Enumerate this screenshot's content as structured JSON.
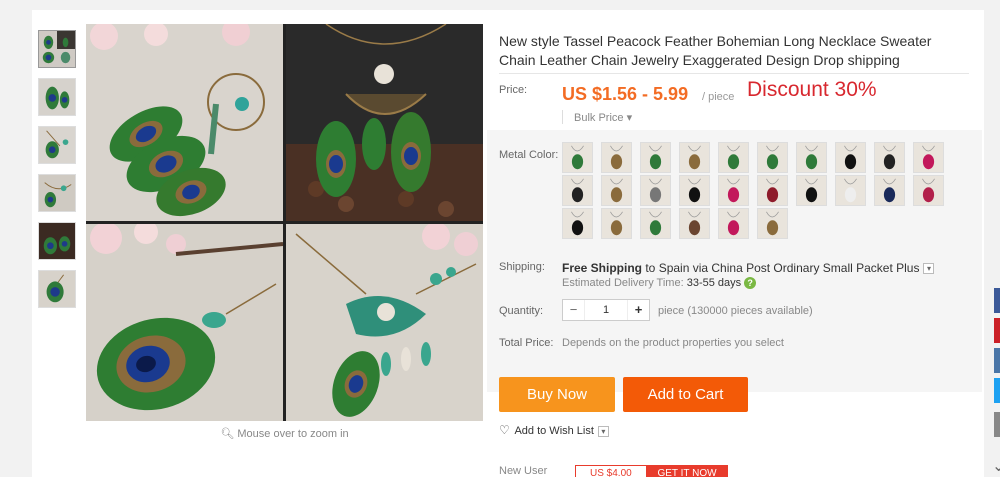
{
  "product": {
    "title": "New style Tassel Peacock Feather Bohemian Long Necklace Sweater Chain Leather Chain Jewelry Exaggerated Design Drop shipping",
    "zoom_hint": "Mouse over to zoom in"
  },
  "price": {
    "label": "Price:",
    "range": "US $1.56 - 5.99",
    "unit": "/ piece",
    "discount": "Discount 30%",
    "bulk_label": "Bulk Price"
  },
  "color": {
    "label": "Metal Color:"
  },
  "shipping": {
    "label": "Shipping:",
    "method_bold": "Free Shipping",
    "method_rest": " to Spain via China Post Ordinary Small Packet Plus",
    "est_prefix": "Estimated Delivery Time:",
    "est_days": "33-55 days"
  },
  "quantity": {
    "label": "Quantity:",
    "minus": "−",
    "value": "1",
    "plus": "+",
    "note": "piece (130000 pieces available)"
  },
  "total": {
    "label": "Total Price:",
    "text": "Depends on the product properties you select"
  },
  "actions": {
    "buy_now": "Buy Now",
    "add_to_cart": "Add to Cart",
    "wishlist": "Add to Wish List"
  },
  "coupon": {
    "label": "New User",
    "amount": "US $4.00",
    "cta": "GET IT NOW"
  },
  "colors": {
    "price": "#f36c24",
    "discount": "#d8282f",
    "buy_now": "#f7941d",
    "add_to_cart": "#f35a07"
  }
}
